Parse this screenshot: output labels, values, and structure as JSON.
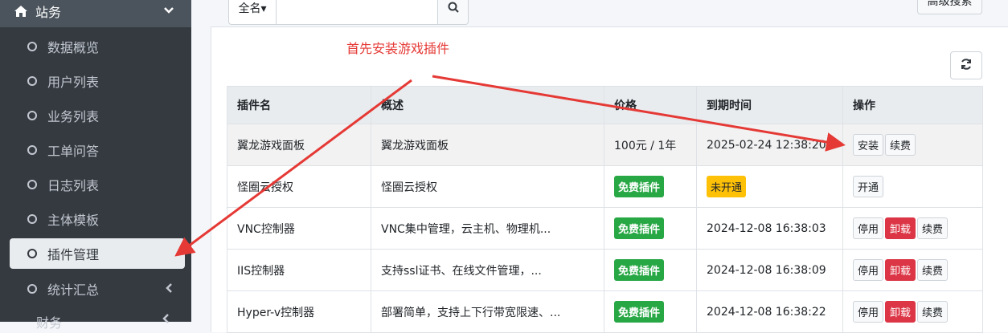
{
  "sidebar": {
    "header_label": "站务",
    "items": [
      {
        "label": "数据概览"
      },
      {
        "label": "用户列表"
      },
      {
        "label": "业务列表"
      },
      {
        "label": "工单问答"
      },
      {
        "label": "日志列表"
      },
      {
        "label": "主体模板"
      },
      {
        "label": "插件管理",
        "active": true
      },
      {
        "label": "统计汇总"
      }
    ],
    "next_section_label": "财务"
  },
  "search": {
    "select_label": "全名▾",
    "advanced_label": "高级搜索"
  },
  "annotation": "首先安装游戏插件",
  "table": {
    "headers": [
      "插件名",
      "概述",
      "价格",
      "到期时间",
      "操作"
    ],
    "rows": [
      {
        "name": "翼龙游戏面板",
        "desc": "翼龙游戏面板",
        "price": "100元 / 1年",
        "expire": "2025-02-24 12:38:20",
        "actions": [
          "安装",
          "续费"
        ]
      },
      {
        "name": "怪圈云授权",
        "desc": "怪圈云授权",
        "price": "免费插件",
        "expire": "未开通",
        "actions": [
          "开通"
        ]
      },
      {
        "name": "VNC控制器",
        "desc": "VNC集中管理，云主机、物理机...",
        "price": "免费插件",
        "expire": "2024-12-08 16:38:03",
        "actions": [
          "停用",
          "卸载",
          "续费"
        ]
      },
      {
        "name": "IIS控制器",
        "desc": "支持ssl证书、在线文件管理，...",
        "price": "免费插件",
        "expire": "2024-12-08 16:38:09",
        "actions": [
          "停用",
          "卸载",
          "续费"
        ]
      },
      {
        "name": "Hyper-v控制器",
        "desc": "部署简单，支持上下行带宽限速、...",
        "price": "免费插件",
        "expire": "2024-12-08 16:38:22",
        "actions": [
          "停用",
          "卸载",
          "续费"
        ]
      }
    ]
  },
  "colors": {
    "sidebar_bg": "#343a40",
    "annotation": "#e53935",
    "success": "#28a745",
    "danger": "#dc3545",
    "warning": "#ffc107"
  }
}
